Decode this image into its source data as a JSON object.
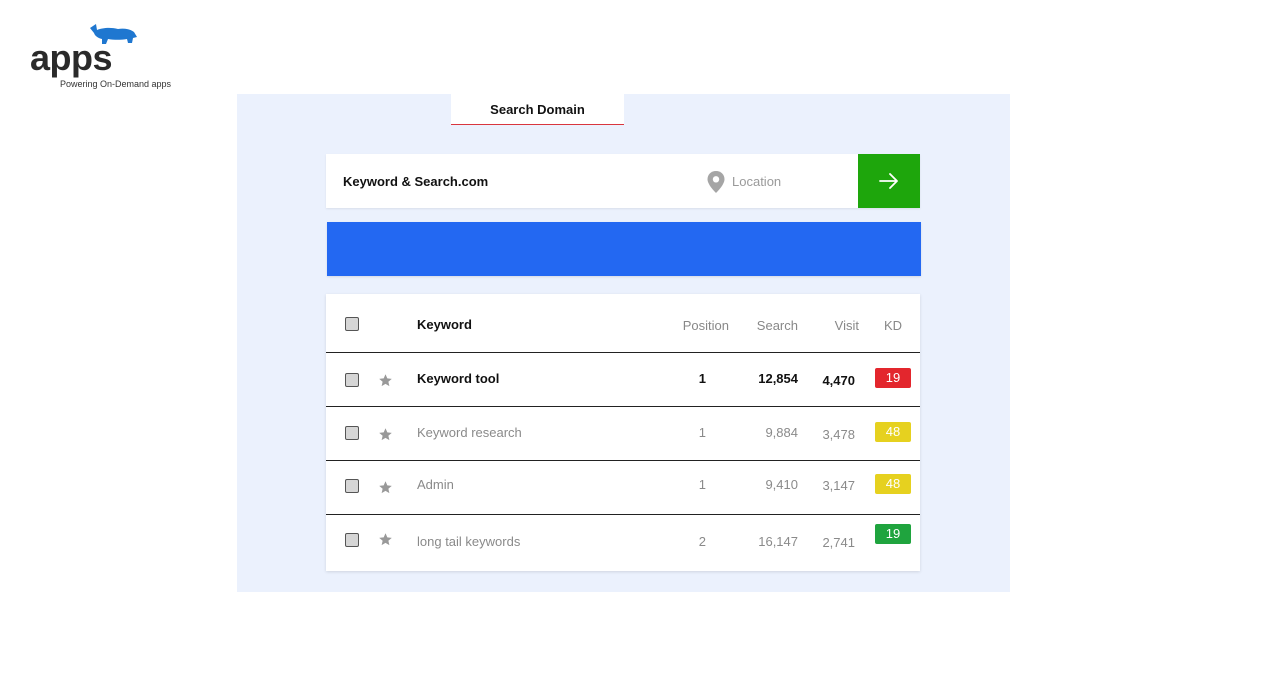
{
  "brand": {
    "logo_text": "apps",
    "tagline": "Powering On-Demand apps",
    "rhino_color": "#1f77d0"
  },
  "tabs": [
    {
      "label": "Search Domain",
      "active": true
    }
  ],
  "search": {
    "domain_value": "Keyword & Search.com",
    "location_placeholder": "Location",
    "go_icon": "arrow-right-icon",
    "location_icon": "map-pin-icon"
  },
  "colors": {
    "accent_green": "#1ea60c",
    "banner_blue": "#2368f2",
    "tab_underline": "#d9363e",
    "kd_red": "#e3262d",
    "kd_yellow": "#e6d11f",
    "kd_green": "#1fa43e"
  },
  "table": {
    "columns": {
      "keyword": "Keyword",
      "position": "Position",
      "search": "Search",
      "visit": "Visit",
      "kd": "KD"
    },
    "rows": [
      {
        "keyword": "Keyword tool",
        "position": "1",
        "search": "12,854",
        "visit": "4,470",
        "kd": "19",
        "kd_color": "#e3262d",
        "highlight": true
      },
      {
        "keyword": "Keyword research",
        "position": "1",
        "search": "9,884",
        "visit": "3,478",
        "kd": "48",
        "kd_color": "#e6d11f",
        "highlight": false
      },
      {
        "keyword": "Admin",
        "position": "1",
        "search": "9,410",
        "visit": "3,147",
        "kd": "48",
        "kd_color": "#e6d11f",
        "highlight": false
      },
      {
        "keyword": "long tail keywords",
        "position": "2",
        "search": "16,147",
        "visit": "2,741",
        "kd": "19",
        "kd_color": "#1fa43e",
        "highlight": false
      }
    ]
  }
}
